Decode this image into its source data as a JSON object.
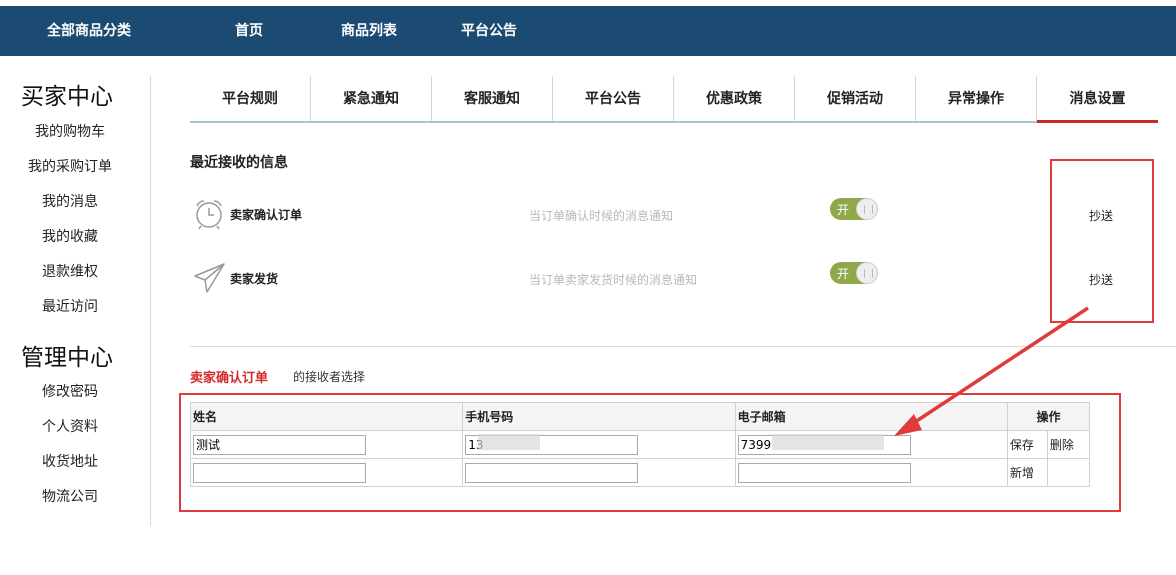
{
  "nav": {
    "items": [
      "全部商品分类",
      "首页",
      "商品列表",
      "平台公告"
    ]
  },
  "sidebar": {
    "buyer_title": "买家中心",
    "buyer_items": [
      "我的购物车",
      "我的采购订单",
      "我的消息",
      "我的收藏",
      "退款维权",
      "最近访问"
    ],
    "admin_title": "管理中心",
    "admin_items": [
      "修改密码",
      "个人资料",
      "收货地址",
      "物流公司"
    ]
  },
  "tabs": [
    "平台规则",
    "紧急通知",
    "客服通知",
    "平台公告",
    "优惠政策",
    "促销活动",
    "异常操作",
    "消息设置"
  ],
  "active_tab": "消息设置",
  "messages": {
    "section_title": "最近接收的信息",
    "items": [
      {
        "icon": "alarm-clock-icon",
        "name": "卖家确认订单",
        "desc": "当订单确认时候的消息通知",
        "toggle": "开",
        "cc": "抄送"
      },
      {
        "icon": "paper-plane-icon",
        "name": "卖家发货",
        "desc": "当订单卖家发货时候的消息通知",
        "toggle": "开",
        "cc": "抄送"
      }
    ]
  },
  "receivers": {
    "title": "卖家确认订单",
    "subtitle": "的接收者选择",
    "headers": {
      "name": "姓名",
      "phone": "手机号码",
      "email": "电子邮箱",
      "actions": "操作"
    },
    "rows": [
      {
        "name": "测试",
        "phone": "13",
        "email": "7399",
        "save": "保存",
        "delete": "删除"
      },
      {
        "name": "",
        "phone": "",
        "email": "",
        "add": "新增"
      }
    ]
  },
  "colors": {
    "nav_bg": "#1b4a72",
    "accent_red": "#e03a3a",
    "toggle_on": "#8fa84a"
  }
}
